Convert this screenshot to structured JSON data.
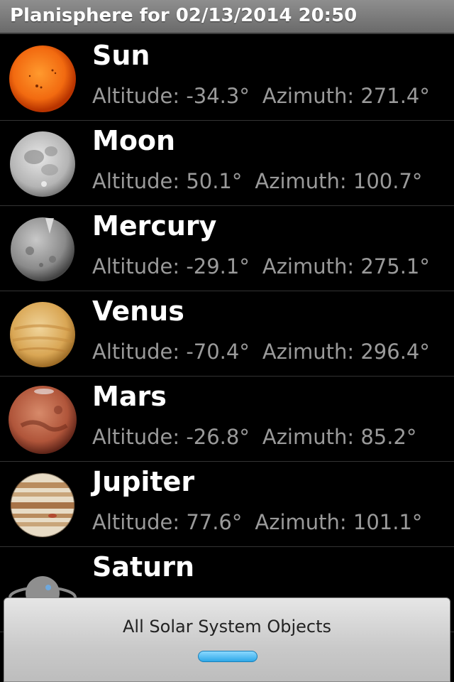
{
  "title": "Planisphere for 02/13/2014 20:50",
  "objects": [
    {
      "name": "Sun",
      "altitude_label": "Altitude: -34.3°",
      "azimuth_label": "Azimuth: 271.4°",
      "icon": "sun-icon"
    },
    {
      "name": "Moon",
      "altitude_label": "Altitude: 50.1°",
      "azimuth_label": "Azimuth: 100.7°",
      "icon": "moon-icon"
    },
    {
      "name": "Mercury",
      "altitude_label": "Altitude: -29.1°",
      "azimuth_label": "Azimuth: 275.1°",
      "icon": "mercury-icon"
    },
    {
      "name": "Venus",
      "altitude_label": "Altitude: -70.4°",
      "azimuth_label": "Azimuth: 296.4°",
      "icon": "venus-icon"
    },
    {
      "name": "Mars",
      "altitude_label": "Altitude: -26.8°",
      "azimuth_label": "Azimuth: 85.2°",
      "icon": "mars-icon"
    },
    {
      "name": "Jupiter",
      "altitude_label": "Altitude: 77.6°",
      "azimuth_label": "Azimuth: 101.1°",
      "icon": "jupiter-icon"
    },
    {
      "name": "Saturn",
      "icon": "saturn-icon"
    }
  ],
  "bottom_panel": {
    "label": "All Solar System Objects"
  },
  "colors": {
    "accent": "#2ea8e8",
    "background": "#000000",
    "secondary_text": "#9a9a9a"
  }
}
